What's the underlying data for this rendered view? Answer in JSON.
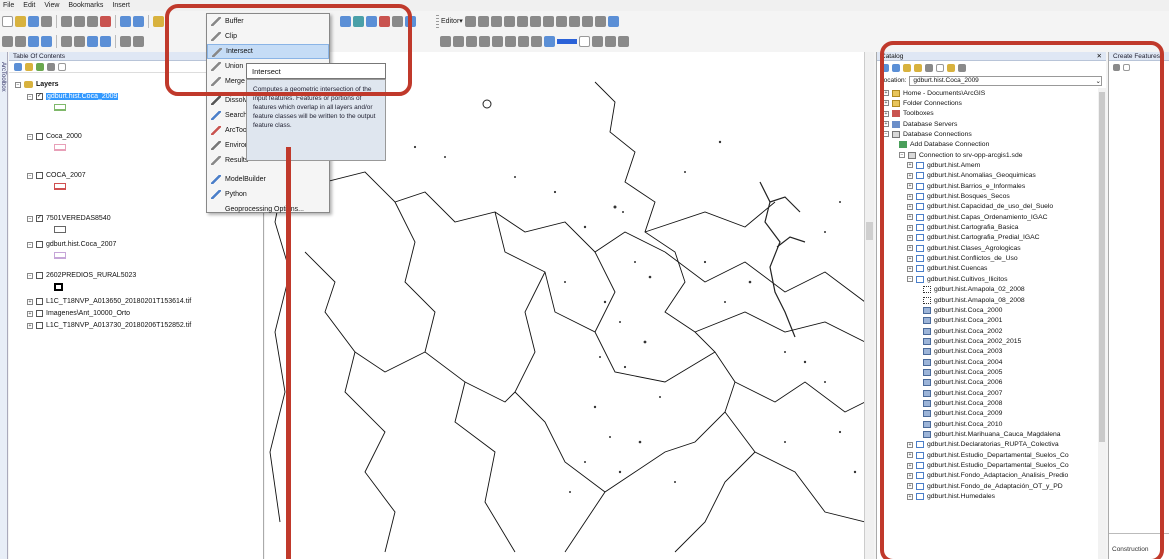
{
  "menu": [
    "File",
    "Edit",
    "View",
    "Bookmarks",
    "Insert"
  ],
  "toolbar": {
    "editor_label": "Editor▾"
  },
  "toc": {
    "title": "Table Of Contents",
    "side_tab": "ArcToolbox",
    "layers_label": "Layers",
    "items": [
      {
        "label": "gdburt.hist.Coca_2009",
        "checked": true,
        "color": "#7fb86a"
      },
      {
        "label": "Coca_2000",
        "checked": false,
        "color": "#e8a0b8"
      },
      {
        "label": "COCA_2007",
        "checked": false,
        "color": "#d05050"
      },
      {
        "label": "7501VEREDAS8540",
        "checked": true,
        "color": "#ffffff"
      },
      {
        "label": "gdburt.hist.Coca_2007",
        "checked": false,
        "color": "#c6a6d8"
      },
      {
        "label": "2602PREDIOS_RURAL5023",
        "checked": false,
        "color": "#000000"
      },
      {
        "label": "L1C_T18NVP_A013650_20180201T153614.tif",
        "checked": false
      },
      {
        "label": "Imagenes\\Ant_10000_Orto",
        "checked": false
      },
      {
        "label": "L1C_T18NVP_A013730_20180206T152852.tif",
        "checked": false
      }
    ]
  },
  "geoprocessing_menu": {
    "items": [
      "Buffer",
      "Clip",
      "Intersect",
      "Union",
      "Merge",
      "Dissolve",
      "Search",
      "ArcToolbox",
      "Environments...",
      "Results",
      "ModelBuilder",
      "Python",
      "Geoprocessing Options..."
    ],
    "highlighted": "Intersect"
  },
  "tooltip": {
    "title": "Intersect",
    "description": "Computes a geometric intersection of the input features. Features or portions of features which overlap in all layers and/or feature classes will be written to the output feature class."
  },
  "catalog": {
    "title": "Catalog",
    "location_label": "Location:",
    "location_value": "gdburt.hist.Coca_2009",
    "items": [
      {
        "label": "Home - Documents\\ArcGIS",
        "level": 0,
        "icon": "folder"
      },
      {
        "label": "Folder Connections",
        "level": 0,
        "icon": "folder"
      },
      {
        "label": "Toolboxes",
        "level": 0,
        "icon": "toolbox"
      },
      {
        "label": "Database Servers",
        "level": 0,
        "icon": "server"
      },
      {
        "label": "Database Connections",
        "level": 0,
        "icon": "db"
      },
      {
        "label": "Add Database Connection",
        "level": 1,
        "icon": "add"
      },
      {
        "label": "Connection to srv-opp-arcgis1.sde",
        "level": 1,
        "icon": "db"
      },
      {
        "label": "gdburt.hist.Amem",
        "level": 2,
        "icon": "dataset"
      },
      {
        "label": "gdburt.hist.Anomalias_Geoquimicas",
        "level": 2,
        "icon": "dataset"
      },
      {
        "label": "gdburt.hist.Barrios_e_Informales",
        "level": 2,
        "icon": "dataset"
      },
      {
        "label": "gdburt.hist.Bosques_Secos",
        "level": 2,
        "icon": "dataset"
      },
      {
        "label": "gdburt.hist.Capacidad_de_uso_del_Suelo",
        "level": 2,
        "icon": "dataset"
      },
      {
        "label": "gdburt.hist.Capas_Ordenamiento_IGAC",
        "level": 2,
        "icon": "dataset"
      },
      {
        "label": "gdburt.hist.Cartografia_Basica",
        "level": 2,
        "icon": "dataset"
      },
      {
        "label": "gdburt.hist.Cartografia_Predial_IGAC",
        "level": 2,
        "icon": "dataset"
      },
      {
        "label": "gdburt.hist.Clases_Agrologicas",
        "level": 2,
        "icon": "dataset"
      },
      {
        "label": "gdburt.hist.Conflictos_de_Uso",
        "level": 2,
        "icon": "dataset"
      },
      {
        "label": "gdburt.hist.Cuencas",
        "level": 2,
        "icon": "dataset"
      },
      {
        "label": "gdburt.hist.Cultivos_Ilicitos",
        "level": 2,
        "icon": "dataset"
      },
      {
        "label": "gdburt.hist.Amapola_02_2008",
        "level": 3,
        "icon": "point"
      },
      {
        "label": "gdburt.hist.Amapola_08_2008",
        "level": 3,
        "icon": "point"
      },
      {
        "label": "gdburt.hist.Coca_2000",
        "level": 3,
        "icon": "poly"
      },
      {
        "label": "gdburt.hist.Coca_2001",
        "level": 3,
        "icon": "poly"
      },
      {
        "label": "gdburt.hist.Coca_2002",
        "level": 3,
        "icon": "poly"
      },
      {
        "label": "gdburt.hist.Coca_2002_2015",
        "level": 3,
        "icon": "poly"
      },
      {
        "label": "gdburt.hist.Coca_2003",
        "level": 3,
        "icon": "poly"
      },
      {
        "label": "gdburt.hist.Coca_2004",
        "level": 3,
        "icon": "poly"
      },
      {
        "label": "gdburt.hist.Coca_2005",
        "level": 3,
        "icon": "poly"
      },
      {
        "label": "gdburt.hist.Coca_2006",
        "level": 3,
        "icon": "poly"
      },
      {
        "label": "gdburt.hist.Coca_2007",
        "level": 3,
        "icon": "poly"
      },
      {
        "label": "gdburt.hist.Coca_2008",
        "level": 3,
        "icon": "poly"
      },
      {
        "label": "gdburt.hist.Coca_2009",
        "level": 3,
        "icon": "poly"
      },
      {
        "label": "gdburt.hist.Coca_2010",
        "level": 3,
        "icon": "poly"
      },
      {
        "label": "gdburt.hist.Marihuana_Cauca_Magdalena",
        "level": 3,
        "icon": "poly"
      },
      {
        "label": "gdburt.hist.Declaratorias_RUPTA_Colectiva",
        "level": 2,
        "icon": "dataset"
      },
      {
        "label": "gdburt.hist.Estudio_Departamental_Suelos_Co",
        "level": 2,
        "icon": "dataset"
      },
      {
        "label": "gdburt.hist.Estudio_Departamental_Suelos_Co",
        "level": 2,
        "icon": "dataset"
      },
      {
        "label": "gdburt.hist.Fondo_Adaptacion_Analisis_Predio",
        "level": 2,
        "icon": "dataset"
      },
      {
        "label": "gdburt.hist.Fondo_de_Adaptación_OT_y_PD",
        "level": 2,
        "icon": "dataset"
      },
      {
        "label": "gdburt.hist.Humedales",
        "level": 2,
        "icon": "dataset"
      }
    ]
  },
  "create_features": {
    "title": "Create Features",
    "construction_label": "Construction"
  },
  "colors": {
    "annotation": "#c0392b",
    "selection": "#3399ff",
    "menu_highlight": "#c5dcf6"
  }
}
